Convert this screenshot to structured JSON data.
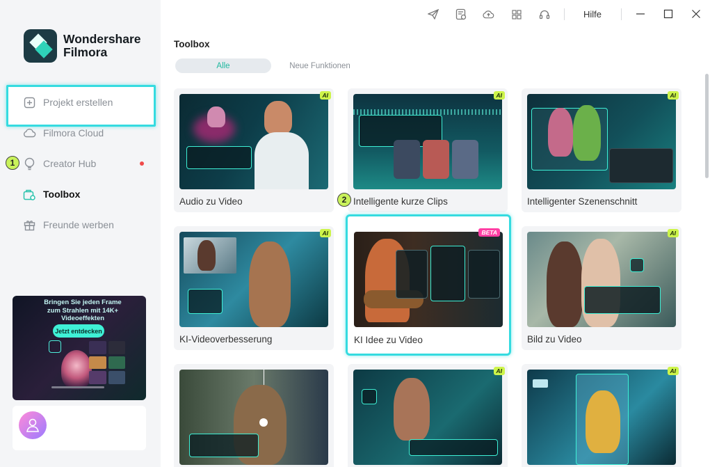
{
  "app": {
    "brand_line1": "Wondershare",
    "brand_line2": "Filmora"
  },
  "topbar": {
    "icons": [
      "paper-plane-icon",
      "task-list-icon",
      "cloud-upload-icon",
      "grid-icon",
      "headset-icon"
    ],
    "help_label": "Hilfe"
  },
  "sidebar": {
    "items": [
      {
        "label": "Projekt erstellen",
        "icon": "plus-square-icon"
      },
      {
        "label": "Filmora Cloud",
        "icon": "cloud-icon"
      },
      {
        "label": "Creator Hub",
        "icon": "bulb-icon"
      },
      {
        "label": "Toolbox",
        "icon": "toolbox-icon"
      },
      {
        "label": "Freunde werben",
        "icon": "gift-icon"
      }
    ],
    "step1": "1",
    "promo": {
      "title": "Bringen Sie jeden Frame zum Strahlen mit 14K+ Videoeffekten",
      "button": "Jetzt entdecken"
    }
  },
  "main": {
    "title": "Toolbox",
    "tabs": [
      {
        "label": "Alle"
      },
      {
        "label": "Neue Funktionen"
      }
    ],
    "step2": "2",
    "cards": [
      {
        "label": "Audio zu Video",
        "badge": "AI"
      },
      {
        "label": "Intelligente kurze Clips",
        "badge": "AI"
      },
      {
        "label": "Intelligenter Szenenschnitt",
        "badge": "AI"
      },
      {
        "label": "KI-Videoverbesserung",
        "badge": "AI"
      },
      {
        "label": "KI Idee zu Video",
        "badge": "BETA"
      },
      {
        "label": "Bild zu Video",
        "badge": "AI"
      },
      {
        "label": "",
        "badge": ""
      },
      {
        "label": "",
        "badge": "AI"
      },
      {
        "label": "",
        "badge": "AI"
      }
    ]
  },
  "colors": {
    "accent": "#35dbe0",
    "brand_teal": "#20b89f",
    "ai_badge": "#cdf44a",
    "beta_badge": "#ff3fa4",
    "notify_dot": "#f04a4a"
  }
}
